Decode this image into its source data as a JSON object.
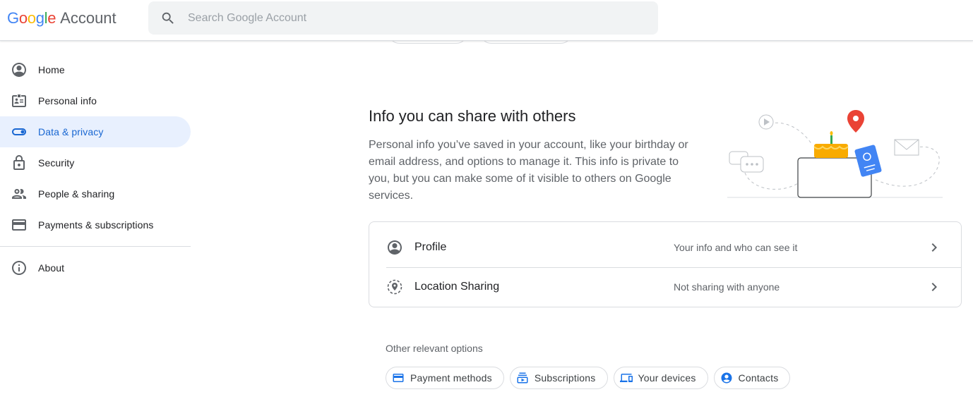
{
  "header": {
    "logo_word": "Google",
    "logo_suffix": "Account",
    "search_placeholder": "Search Google Account"
  },
  "colors": {
    "accent": "#1a73e8",
    "active_bg": "#e8f0fe",
    "active_text": "#1967d2",
    "border": "#dadce0",
    "secondary_text": "#5f6368"
  },
  "sidebar": {
    "items": [
      {
        "label": "Home",
        "icon": "account-circle-icon",
        "active": false
      },
      {
        "label": "Personal info",
        "icon": "id-card-icon",
        "active": false
      },
      {
        "label": "Data & privacy",
        "icon": "toggle-icon",
        "active": true
      },
      {
        "label": "Security",
        "icon": "lock-icon",
        "active": false
      },
      {
        "label": "People & sharing",
        "icon": "people-icon",
        "active": false
      },
      {
        "label": "Payments & subscriptions",
        "icon": "credit-card-icon",
        "active": false
      }
    ],
    "footer_items": [
      {
        "label": "About",
        "icon": "info-icon"
      }
    ]
  },
  "main": {
    "section_title": "Info you can share with others",
    "section_desc": "Personal info you’ve saved in your account, like your birthday or email address, and options to manage it. This info is private to you, but you can make some of it visible to others on Google services.",
    "rows": [
      {
        "label": "Profile",
        "value": "Your info and who can see it",
        "icon": "account-circle-icon"
      },
      {
        "label": "Location Sharing",
        "value": "Not sharing with anyone",
        "icon": "location-sharing-icon"
      }
    ],
    "other_label": "Other relevant options",
    "chips": [
      {
        "label": "Payment methods",
        "icon": "credit-card-icon"
      },
      {
        "label": "Subscriptions",
        "icon": "subscriptions-icon"
      },
      {
        "label": "Your devices",
        "icon": "devices-icon"
      },
      {
        "label": "Contacts",
        "icon": "contacts-icon"
      }
    ]
  }
}
